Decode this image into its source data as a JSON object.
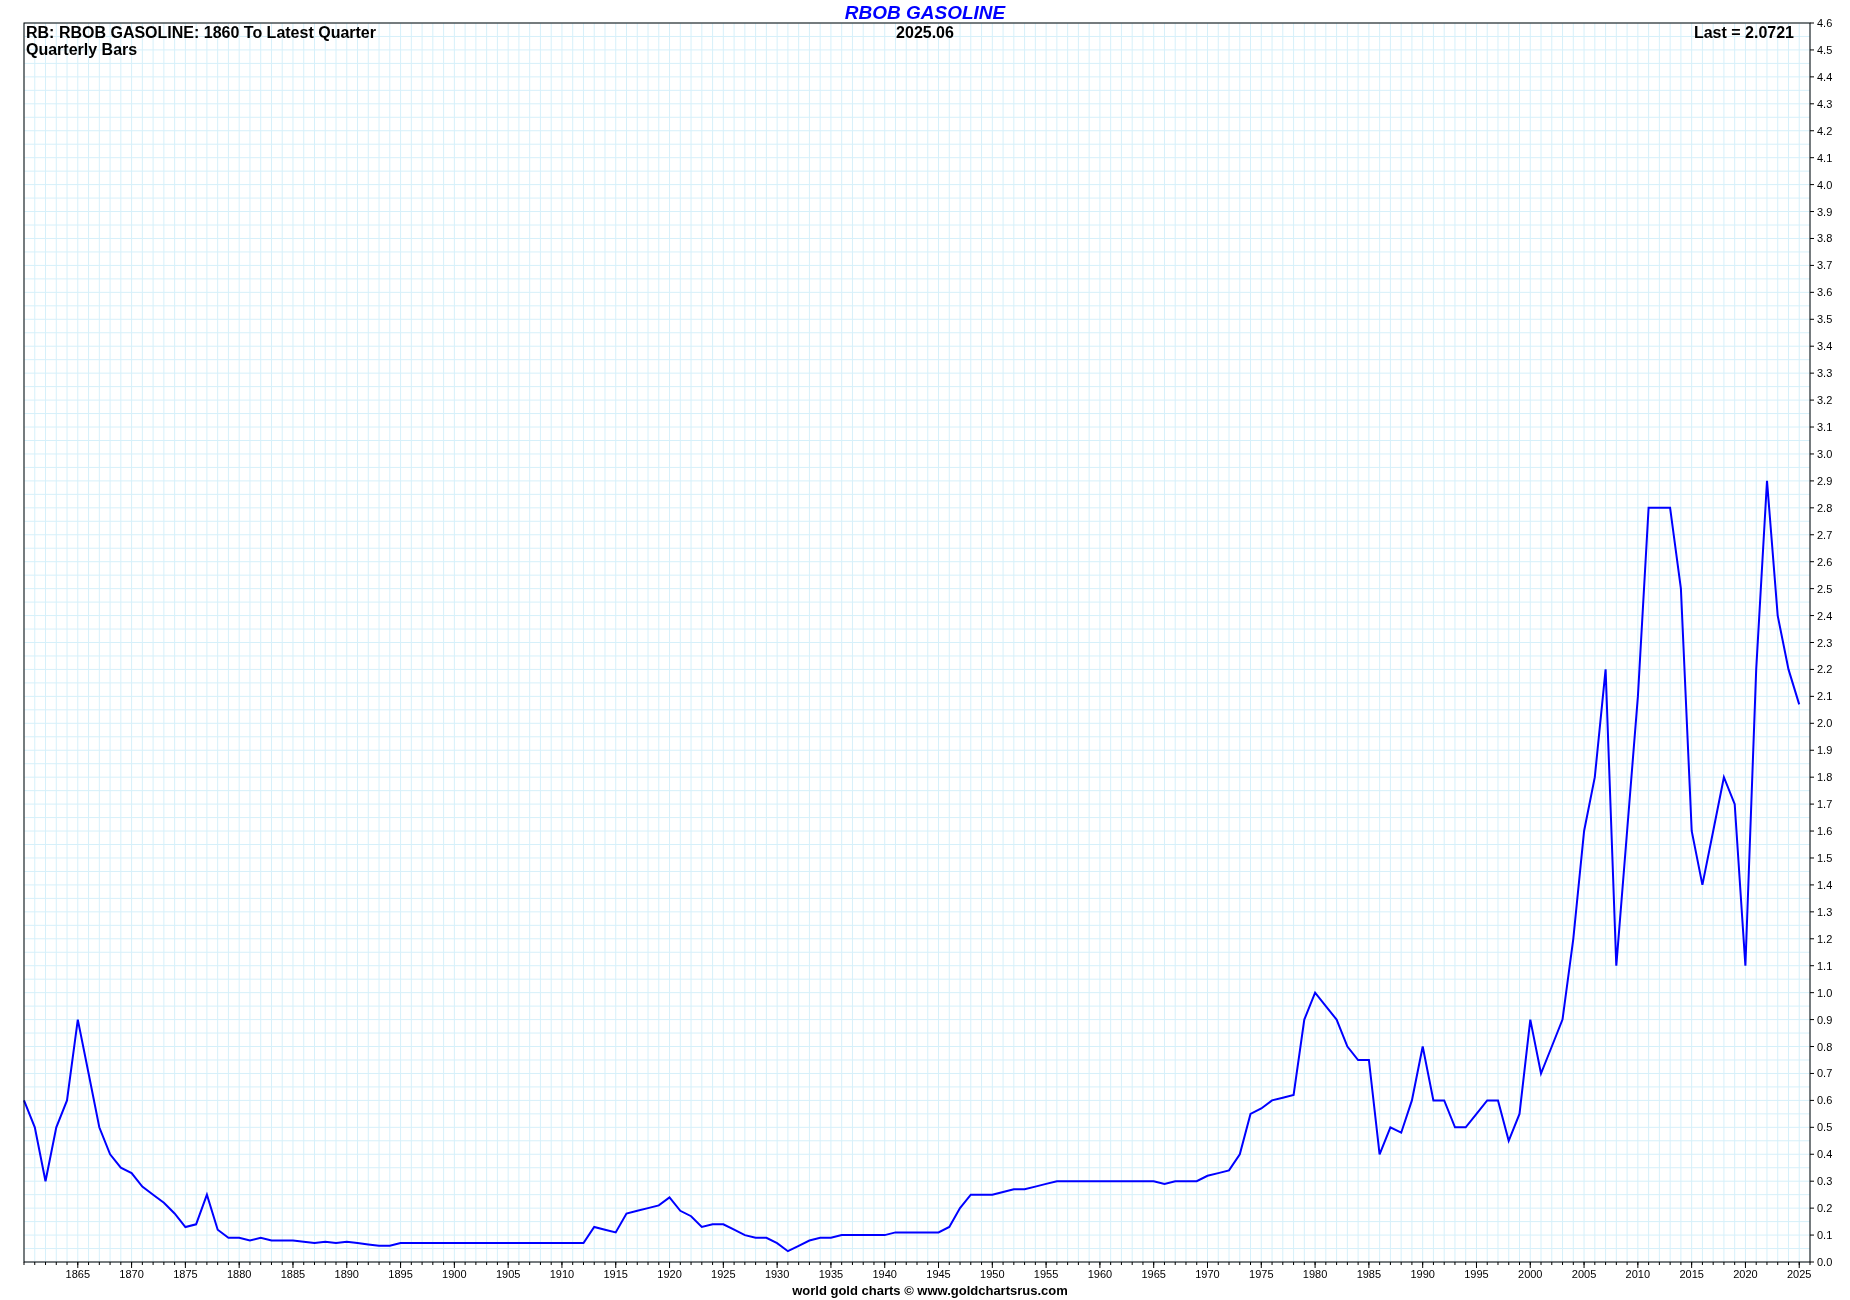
{
  "header": {
    "subtitle": "RB: RBOB GASOLINE: 1860 To Latest Quarter",
    "bar_type": "Quarterly Bars",
    "date": "2025.06",
    "last": "Last = 2.0721"
  },
  "chart_data": {
    "type": "line",
    "title": "RBOB GASOLINE",
    "x": [
      1860,
      1861,
      1862,
      1863,
      1864,
      1865,
      1866,
      1867,
      1868,
      1869,
      1870,
      1871,
      1872,
      1873,
      1874,
      1875,
      1876,
      1877,
      1878,
      1879,
      1880,
      1881,
      1882,
      1883,
      1884,
      1885,
      1886,
      1887,
      1888,
      1889,
      1890,
      1891,
      1892,
      1893,
      1894,
      1895,
      1896,
      1897,
      1898,
      1899,
      1900,
      1901,
      1902,
      1903,
      1904,
      1905,
      1906,
      1907,
      1908,
      1909,
      1910,
      1911,
      1912,
      1913,
      1914,
      1915,
      1916,
      1917,
      1918,
      1919,
      1920,
      1921,
      1922,
      1923,
      1924,
      1925,
      1926,
      1927,
      1928,
      1929,
      1930,
      1931,
      1932,
      1933,
      1934,
      1935,
      1936,
      1937,
      1938,
      1939,
      1940,
      1941,
      1942,
      1943,
      1944,
      1945,
      1946,
      1947,
      1948,
      1949,
      1950,
      1951,
      1952,
      1953,
      1954,
      1955,
      1956,
      1957,
      1958,
      1959,
      1960,
      1961,
      1962,
      1963,
      1964,
      1965,
      1966,
      1967,
      1968,
      1969,
      1970,
      1971,
      1972,
      1973,
      1974,
      1975,
      1976,
      1977,
      1978,
      1979,
      1980,
      1981,
      1982,
      1983,
      1984,
      1985,
      1986,
      1987,
      1988,
      1989,
      1990,
      1991,
      1992,
      1993,
      1994,
      1995,
      1996,
      1997,
      1998,
      1999,
      2000,
      2001,
      2002,
      2003,
      2004,
      2005,
      2006,
      2007,
      2008,
      2009,
      2010,
      2011,
      2012,
      2013,
      2014,
      2015,
      2016,
      2017,
      2018,
      2019,
      2020,
      2021,
      2022,
      2023,
      2024,
      2025
    ],
    "series": [
      {
        "color": "#0000ff",
        "values": [
          0.6,
          0.5,
          0.3,
          0.5,
          0.6,
          0.9,
          0.7,
          0.5,
          0.4,
          0.35,
          0.33,
          0.28,
          0.25,
          0.22,
          0.18,
          0.13,
          0.14,
          0.25,
          0.12,
          0.09,
          0.09,
          0.08,
          0.09,
          0.08,
          0.08,
          0.08,
          0.075,
          0.07,
          0.075,
          0.07,
          0.075,
          0.07,
          0.065,
          0.06,
          0.06,
          0.07,
          0.07,
          0.07,
          0.07,
          0.07,
          0.07,
          0.07,
          0.07,
          0.07,
          0.07,
          0.07,
          0.07,
          0.07,
          0.07,
          0.07,
          0.07,
          0.07,
          0.07,
          0.13,
          0.12,
          0.11,
          0.18,
          0.19,
          0.2,
          0.21,
          0.24,
          0.19,
          0.17,
          0.13,
          0.14,
          0.14,
          0.12,
          0.1,
          0.09,
          0.09,
          0.07,
          0.04,
          0.06,
          0.08,
          0.09,
          0.09,
          0.1,
          0.1,
          0.1,
          0.1,
          0.1,
          0.11,
          0.11,
          0.11,
          0.11,
          0.11,
          0.13,
          0.2,
          0.25,
          0.25,
          0.25,
          0.26,
          0.27,
          0.27,
          0.28,
          0.29,
          0.3,
          0.3,
          0.3,
          0.3,
          0.3,
          0.3,
          0.3,
          0.3,
          0.3,
          0.3,
          0.29,
          0.3,
          0.3,
          0.3,
          0.32,
          0.33,
          0.34,
          0.4,
          0.55,
          0.57,
          0.6,
          0.61,
          0.62,
          0.9,
          1.0,
          0.95,
          0.9,
          0.8,
          0.75,
          0.75,
          0.4,
          0.5,
          0.48,
          0.6,
          0.8,
          0.6,
          0.6,
          0.5,
          0.5,
          0.55,
          0.6,
          0.6,
          0.45,
          0.55,
          0.9,
          0.7,
          0.8,
          0.9,
          1.2,
          1.6,
          1.8,
          2.2,
          1.1,
          1.6,
          2.1,
          2.8,
          2.8,
          2.8,
          2.5,
          1.6,
          1.4,
          1.6,
          1.8,
          1.7,
          1.1,
          2.2,
          2.9,
          2.4,
          2.2,
          2.07
        ]
      }
    ],
    "grid": true,
    "xlim": [
      1860,
      2026
    ],
    "ylim": [
      0,
      4.6
    ],
    "xticks": [
      1865,
      1870,
      1875,
      1880,
      1885,
      1890,
      1895,
      1900,
      1905,
      1910,
      1915,
      1920,
      1925,
      1930,
      1935,
      1940,
      1945,
      1950,
      1955,
      1960,
      1965,
      1970,
      1975,
      1980,
      1985,
      1990,
      1995,
      2000,
      2005,
      2010,
      2015,
      2020,
      2025
    ],
    "yticks": [
      {
        "value": 0,
        "label": "0.0"
      },
      {
        "value": 0.1,
        "label": "0.1"
      },
      {
        "value": 0.2,
        "label": "0.2"
      },
      {
        "value": 0.3,
        "label": "0.3"
      },
      {
        "value": 0.4,
        "label": "0.4"
      },
      {
        "value": 0.5,
        "label": "0.5"
      },
      {
        "value": 0.6,
        "label": "0.6"
      },
      {
        "value": 0.7,
        "label": "0.7"
      },
      {
        "value": 0.8,
        "label": "0.8"
      },
      {
        "value": 0.9,
        "label": "0.9"
      },
      {
        "value": 1,
        "label": "1.0"
      },
      {
        "value": 1.1,
        "label": "1.1"
      },
      {
        "value": 1.2,
        "label": "1.2"
      },
      {
        "value": 1.3,
        "label": "1.3"
      },
      {
        "value": 1.4,
        "label": "1.4"
      },
      {
        "value": 1.5,
        "label": "1.5"
      },
      {
        "value": 1.6,
        "label": "1.6"
      },
      {
        "value": 1.7,
        "label": "1.7"
      },
      {
        "value": 1.8,
        "label": "1.8"
      },
      {
        "value": 1.9,
        "label": "1.9"
      },
      {
        "value": 2,
        "label": "2.0"
      },
      {
        "value": 2.1,
        "label": "2.1"
      },
      {
        "value": 2.2,
        "label": "2.2"
      },
      {
        "value": 2.3,
        "label": "2.3"
      },
      {
        "value": 2.4,
        "label": "2.4"
      },
      {
        "value": 2.5,
        "label": "2.5"
      },
      {
        "value": 2.6,
        "label": "2.6"
      },
      {
        "value": 2.7,
        "label": "2.7"
      },
      {
        "value": 2.8,
        "label": "2.8"
      },
      {
        "value": 2.9,
        "label": "2.9"
      },
      {
        "value": 3,
        "label": "3.0"
      },
      {
        "value": 3.1,
        "label": "3.1"
      },
      {
        "value": 3.2,
        "label": "3.2"
      },
      {
        "value": 3.3,
        "label": "3.3"
      },
      {
        "value": 3.4,
        "label": "3.4"
      },
      {
        "value": 3.5,
        "label": "3.5"
      },
      {
        "value": 3.6,
        "label": "3.6"
      },
      {
        "value": 3.7,
        "label": "3.7"
      },
      {
        "value": 3.8,
        "label": "3.8"
      },
      {
        "value": 3.9,
        "label": "3.9"
      },
      {
        "value": 4,
        "label": "4.0"
      },
      {
        "value": 4.1,
        "label": "4.1"
      },
      {
        "value": 4.2,
        "label": "4.2"
      },
      {
        "value": 4.3,
        "label": "4.3"
      },
      {
        "value": 4.4,
        "label": "4.4"
      },
      {
        "value": 4.5,
        "label": "4.5"
      },
      {
        "value": 4.6,
        "label": "4.6"
      }
    ]
  },
  "footer": "world gold charts © www.goldchartsrus.com"
}
